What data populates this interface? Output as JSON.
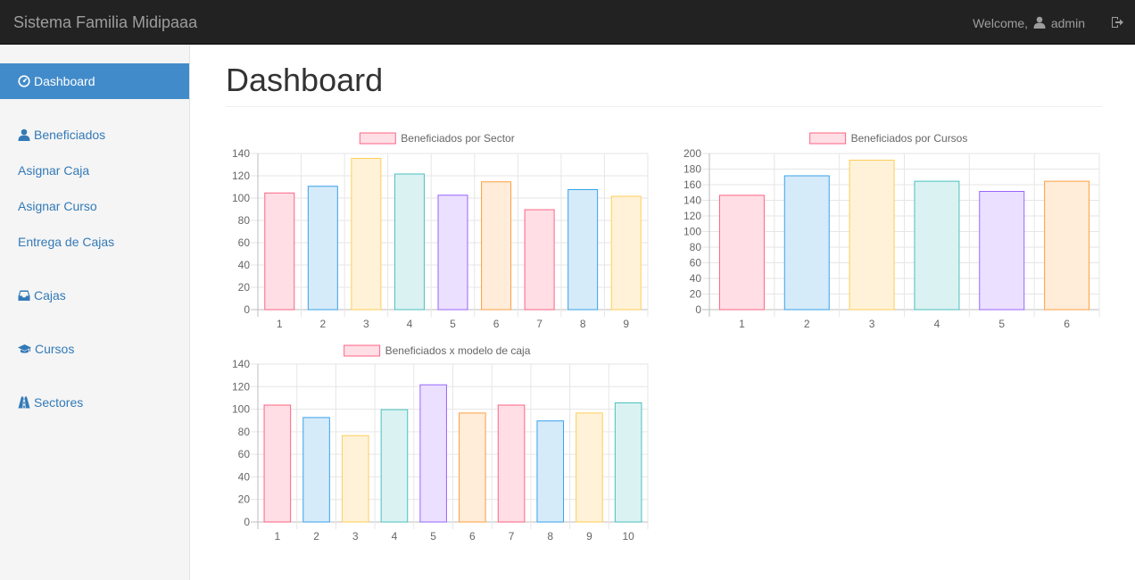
{
  "navbar": {
    "brand": "Sistema Familia Midipaaa",
    "welcome_prefix": "Welcome,",
    "username": "admin"
  },
  "sidebar": {
    "items": [
      {
        "label": "Dashboard",
        "icon": "dashboard-icon",
        "active": true
      },
      {
        "label": "Beneficiados",
        "icon": "user-icon"
      },
      {
        "label": "Asignar Caja"
      },
      {
        "label": "Asignar Curso"
      },
      {
        "label": "Entrega de Cajas"
      },
      {
        "label": "Cajas",
        "icon": "inbox-icon"
      },
      {
        "label": "Cursos",
        "icon": "graduation-cap-icon"
      },
      {
        "label": "Sectores",
        "icon": "road-icon"
      }
    ]
  },
  "page": {
    "title": "Dashboard"
  },
  "chart_data": [
    {
      "type": "bar",
      "title": "",
      "legend": "Beneficiados por Sector",
      "legend_position": "top",
      "categories": [
        "1",
        "2",
        "3",
        "4",
        "5",
        "6",
        "7",
        "8",
        "9"
      ],
      "values": [
        105,
        111,
        136,
        122,
        103,
        115,
        90,
        108,
        102
      ],
      "ylim": [
        0,
        140
      ],
      "yticks": [
        0,
        20,
        40,
        60,
        80,
        100,
        120,
        140
      ],
      "grid": true
    },
    {
      "type": "bar",
      "title": "",
      "legend": "Beneficiados por Cursos",
      "legend_position": "top",
      "categories": [
        "1",
        "2",
        "3",
        "4",
        "5",
        "6"
      ],
      "values": [
        147,
        172,
        192,
        165,
        152,
        165
      ],
      "ylim": [
        0,
        200
      ],
      "yticks": [
        0,
        20,
        40,
        60,
        80,
        100,
        120,
        140,
        160,
        180,
        200
      ],
      "grid": true
    },
    {
      "type": "bar",
      "title": "",
      "legend": "Beneficiados x modelo de caja",
      "legend_position": "top",
      "categories": [
        "1",
        "2",
        "3",
        "4",
        "5",
        "6",
        "7",
        "8",
        "9",
        "10"
      ],
      "values": [
        104,
        93,
        77,
        100,
        122,
        97,
        104,
        90,
        97,
        106
      ],
      "ylim": [
        0,
        140
      ],
      "yticks": [
        0,
        20,
        40,
        60,
        80,
        100,
        120,
        140
      ],
      "grid": true
    }
  ],
  "colors": {
    "bar_fills": [
      "#ffdfe5",
      "#d6ebf9",
      "#fff2d8",
      "#dbf2f2",
      "#ebe0ff",
      "#ffecd9"
    ],
    "bar_borders": [
      "#ff6384",
      "#36a2eb",
      "#ffce56",
      "#4bc0c0",
      "#9966ff",
      "#ff9f40"
    ],
    "active_nav": "#428bca",
    "link": "#337ab7"
  }
}
